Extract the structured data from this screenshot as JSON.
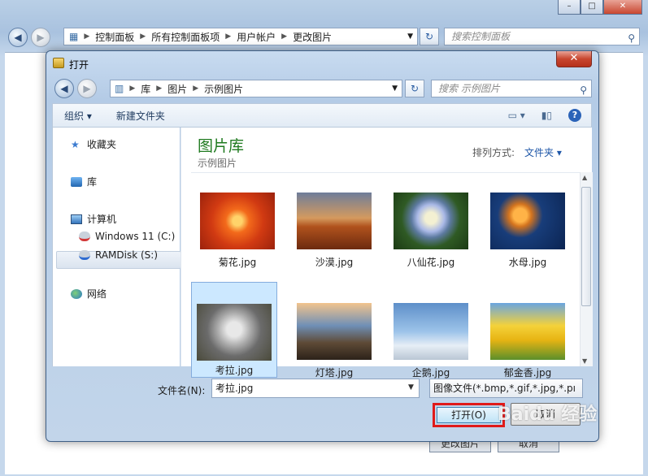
{
  "background_window": {
    "address_crumbs": [
      "控制面板",
      "所有控制面板项",
      "用户帐户",
      "更改图片"
    ],
    "search_placeholder": "搜索控制面板",
    "caption_buttons": [
      "–",
      "□",
      "✕"
    ],
    "bottom_buttons": [
      "更改图片",
      "取消"
    ]
  },
  "dialog": {
    "title": "打开",
    "close_label": "✕",
    "address_crumbs": [
      "库",
      "图片",
      "示例图片"
    ],
    "search_placeholder": "搜索 示例图片",
    "toolbar": {
      "organize_label": "组织 ▾",
      "new_folder_label": "新建文件夹"
    },
    "nav": {
      "favorites": "收藏夹",
      "libraries": "库",
      "computer": "计算机",
      "drive_c": "Windows 11 (C:)",
      "drive_s": "RAMDisk (S:)",
      "network": "网络"
    },
    "library": {
      "title": "图片库",
      "subtitle": "示例图片",
      "sort_label": "排列方式:",
      "sort_value": "文件夹 ▾"
    },
    "thumbnails": [
      {
        "name": "菊花.jpg"
      },
      {
        "name": "沙漠.jpg"
      },
      {
        "name": "八仙花.jpg"
      },
      {
        "name": "水母.jpg"
      },
      {
        "name": "考拉.jpg",
        "selected": true
      },
      {
        "name": "灯塔.jpg"
      },
      {
        "name": "企鹅.jpg"
      },
      {
        "name": "郁金香.jpg"
      }
    ],
    "filename_label": "文件名(N):",
    "filename_value": "考拉.jpg",
    "filetype_value": "图像文件(*.bmp,*.gif,*.jpg,*.pı",
    "open_label": "打开(O)",
    "cancel_label": "取消"
  },
  "colors": {
    "highlight_box": "#e01a1a",
    "library_title": "#1f7a1f",
    "selected_tile": "#cce8ff"
  },
  "watermark": "Baidu 经验"
}
